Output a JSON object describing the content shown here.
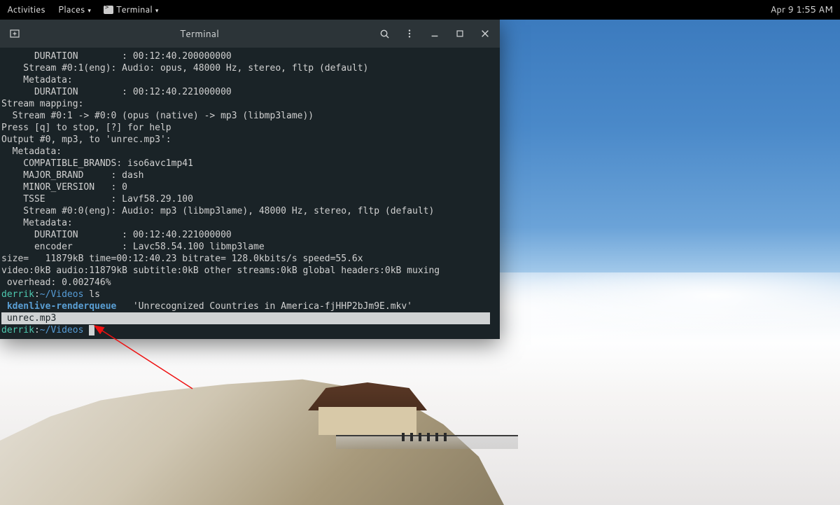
{
  "panel": {
    "activities": "Activities",
    "places": "Places",
    "app_label": "Terminal",
    "datetime": "Apr 9  1:55 AM"
  },
  "window": {
    "title": "Terminal"
  },
  "terminal": {
    "lines": [
      {
        "indent": "      ",
        "text": "DURATION        : 00:12:40.200000000"
      },
      {
        "indent": "    ",
        "text": "Stream #0:1(eng): Audio: opus, 48000 Hz, stereo, fltp (default)"
      },
      {
        "indent": "    ",
        "text": "Metadata:"
      },
      {
        "indent": "      ",
        "text": "DURATION        : 00:12:40.221000000"
      },
      {
        "indent": "",
        "text": "Stream mapping:"
      },
      {
        "indent": "  ",
        "text": "Stream #0:1 -> #0:0 (opus (native) -> mp3 (libmp3lame))"
      },
      {
        "indent": "",
        "text": "Press [q] to stop, [?] for help"
      },
      {
        "indent": "",
        "text": "Output #0, mp3, to 'unrec.mp3':"
      },
      {
        "indent": "  ",
        "text": "Metadata:"
      },
      {
        "indent": "    ",
        "text": "COMPATIBLE_BRANDS: iso6avc1mp41"
      },
      {
        "indent": "    ",
        "text": "MAJOR_BRAND     : dash"
      },
      {
        "indent": "    ",
        "text": "MINOR_VERSION   : 0"
      },
      {
        "indent": "    ",
        "text": "TSSE            : Lavf58.29.100"
      },
      {
        "indent": "    ",
        "text": "Stream #0:0(eng): Audio: mp3 (libmp3lame), 48000 Hz, stereo, fltp (default)"
      },
      {
        "indent": "    ",
        "text": "Metadata:"
      },
      {
        "indent": "      ",
        "text": "DURATION        : 00:12:40.221000000"
      },
      {
        "indent": "      ",
        "text": "encoder         : Lavc58.54.100 libmp3lame"
      },
      {
        "indent": "",
        "text": "size=   11879kB time=00:12:40.23 bitrate= 128.0kbits/s speed=55.6x"
      },
      {
        "indent": "",
        "text": "video:0kB audio:11879kB subtitle:0kB other streams:0kB global headers:0kB muxing"
      },
      {
        "indent": " ",
        "text": "overhead: 0.002746%"
      }
    ],
    "prompt1": {
      "user": "derrik",
      "sep": ":",
      "path": "~/Videos",
      "cmd": " ls"
    },
    "ls_output": {
      "item1": " kdenlive-renderqueue ",
      "item2": "  'Unrecognized Countries in America-fjHHP2bJm9E.mkv'",
      "highlighted": " unrec.mp3"
    },
    "prompt2": {
      "user": "derrik",
      "sep": ":",
      "path": "~/Videos"
    }
  }
}
